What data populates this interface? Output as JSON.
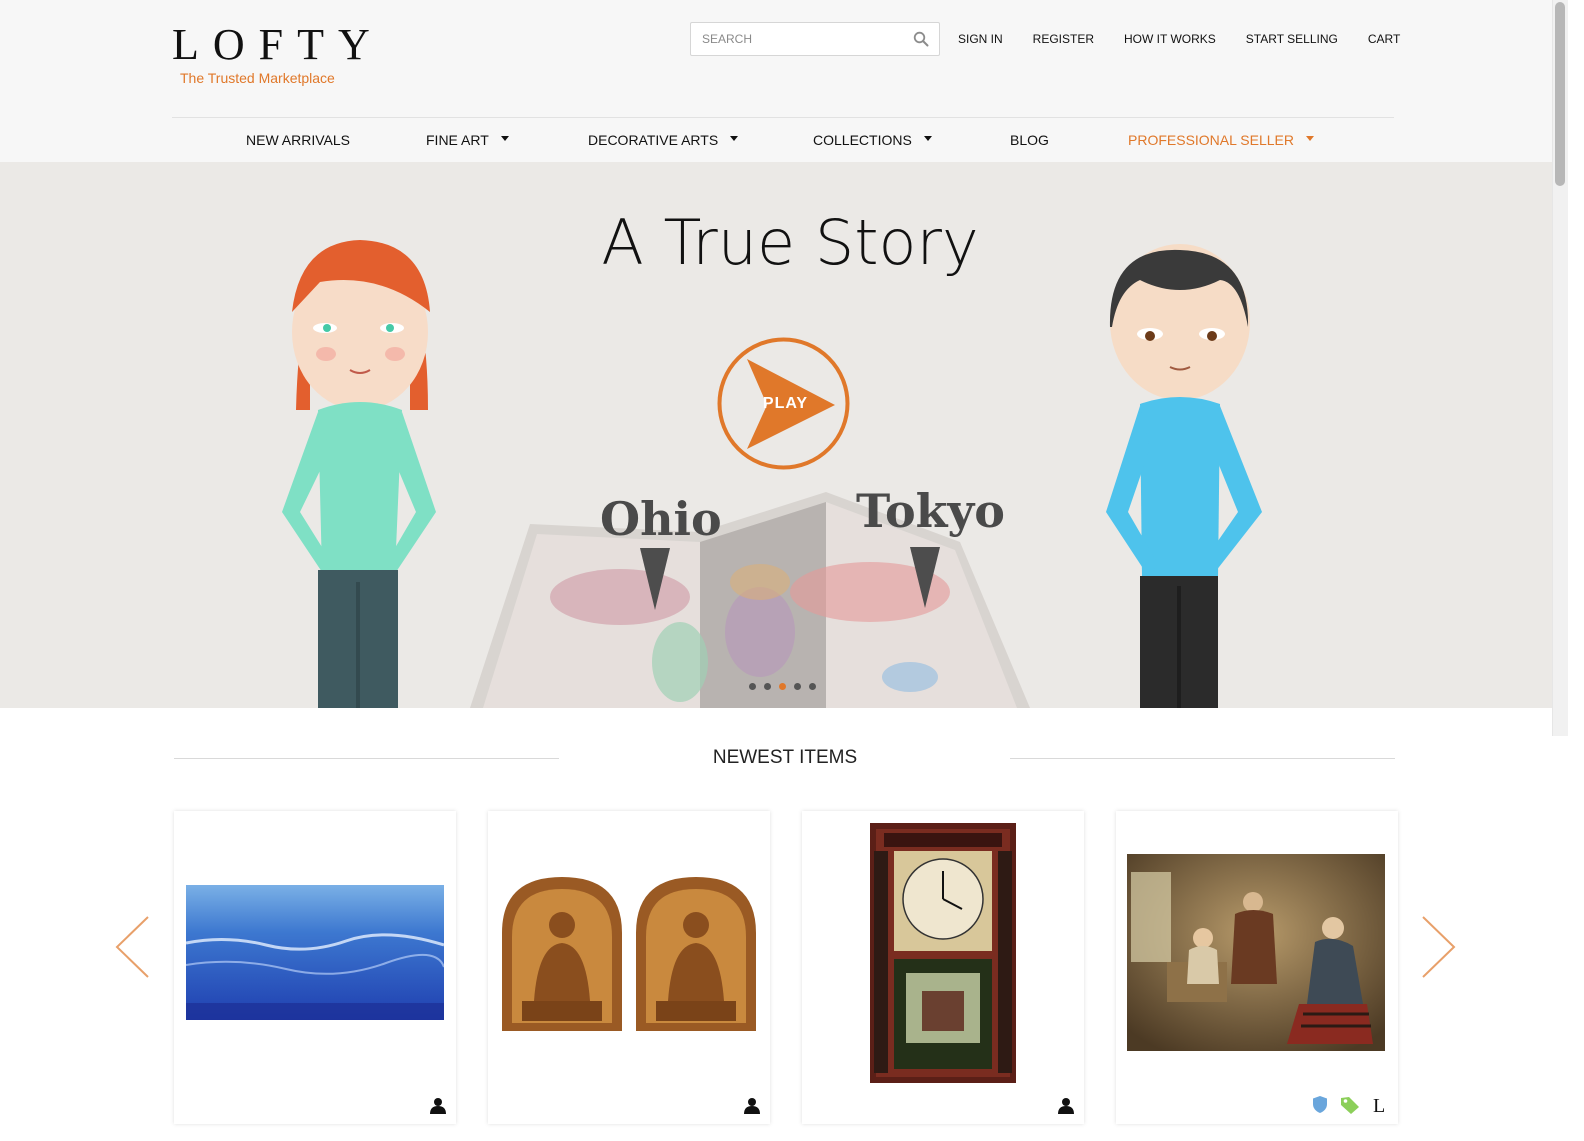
{
  "brand": {
    "name": "LOFTY",
    "tagline": "The Trusted Marketplace",
    "accent_color": "#e0782a"
  },
  "search": {
    "placeholder": "SEARCH",
    "icon": "search-icon"
  },
  "top_links": [
    {
      "label": "SIGN IN"
    },
    {
      "label": "REGISTER"
    },
    {
      "label": "HOW IT WORKS"
    },
    {
      "label": "START SELLING"
    },
    {
      "label": "CART"
    }
  ],
  "nav": [
    {
      "label": "NEW ARRIVALS",
      "dropdown": false
    },
    {
      "label": "FINE ART",
      "dropdown": true
    },
    {
      "label": "DECORATIVE ARTS",
      "dropdown": true
    },
    {
      "label": "COLLECTIONS",
      "dropdown": true
    },
    {
      "label": "BLOG",
      "dropdown": false
    },
    {
      "label": "PROFESSIONAL SELLER",
      "dropdown": true,
      "highlight": true
    }
  ],
  "hero": {
    "title": "A True Story",
    "play_label": "PLAY",
    "places": [
      "Ohio",
      "Tokyo"
    ],
    "slides": 5,
    "active_slide": 3
  },
  "newest": {
    "title": "NEWEST ITEMS",
    "items": [
      {
        "image": "ocean-painting",
        "badges": [
          "user-icon"
        ]
      },
      {
        "image": "buddha-bookends",
        "badges": [
          "user-icon"
        ]
      },
      {
        "image": "shelf-clock",
        "badges": [
          "user-icon"
        ]
      },
      {
        "image": "genre-painting",
        "badges": [
          "shield-icon",
          "tag-icon",
          "lofty-l-icon"
        ]
      }
    ],
    "prev_icon": "chevron-left-icon",
    "next_icon": "chevron-right-icon"
  }
}
